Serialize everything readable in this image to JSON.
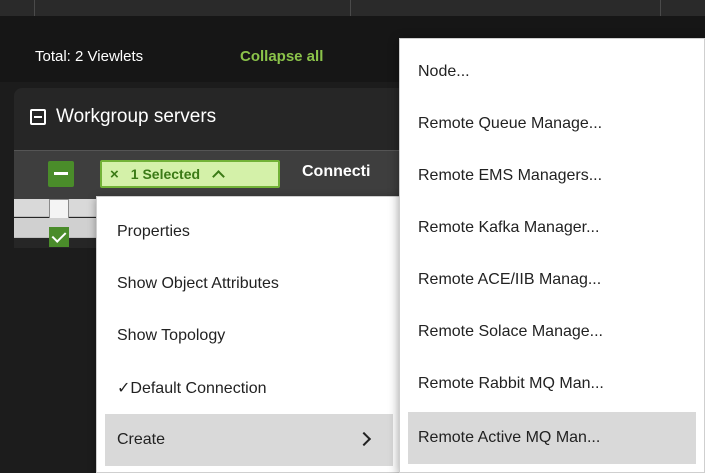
{
  "toolbar": {
    "total_label": "Total: 2 Viewlets",
    "collapse_label": "Collapse all"
  },
  "panel": {
    "title": "Workgroup servers"
  },
  "grid": {
    "selected_label": "1 Selected",
    "clear_icon": "×",
    "column_connection": "Connecti",
    "rows": [
      {
        "checked": false
      },
      {
        "checked": true
      }
    ]
  },
  "context_menu": {
    "items": [
      {
        "label": "Properties"
      },
      {
        "label": "Show Object Attributes"
      },
      {
        "label": "Show Topology"
      },
      {
        "label": "✓Default Connection"
      },
      {
        "label": "Create",
        "submenu": true,
        "highlighted": true
      }
    ]
  },
  "create_submenu": {
    "items": [
      {
        "label": "Node..."
      },
      {
        "label": "Remote Queue Manage..."
      },
      {
        "label": "Remote EMS Managers..."
      },
      {
        "label": "Remote Kafka Manager..."
      },
      {
        "label": "Remote ACE/IIB Manag..."
      },
      {
        "label": "Remote Solace Manage..."
      },
      {
        "label": "Remote Rabbit MQ Man..."
      },
      {
        "label": "Remote Active MQ Man...",
        "highlighted": true
      }
    ]
  },
  "colors": {
    "accent_green": "#8bc34a",
    "check_green": "#4a8c2a",
    "chip_bg": "#d4f1a9"
  }
}
